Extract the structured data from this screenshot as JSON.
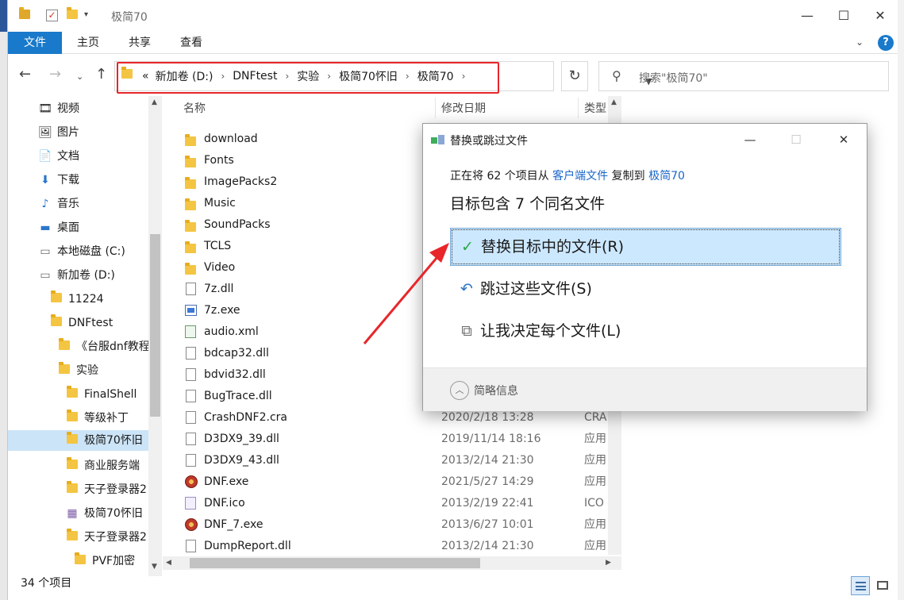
{
  "window": {
    "title": "极简70",
    "minimize_glyph": "—",
    "maximize_glyph": "☐",
    "close_glyph": "✕"
  },
  "ribbon": {
    "file": "文件",
    "home": "主页",
    "share": "共享",
    "view": "查看",
    "help": "?"
  },
  "address": {
    "overflow": "«",
    "crumbs": [
      "新加卷 (D:)",
      "DNFtest",
      "实验",
      "极简70怀旧",
      "极简70"
    ],
    "search_placeholder": "搜索\"极简70\""
  },
  "nav": {
    "items": [
      {
        "label": "视频",
        "icon": "video-icon"
      },
      {
        "label": "图片",
        "icon": "pictures-icon"
      },
      {
        "label": "文档",
        "icon": "documents-icon"
      },
      {
        "label": "下载",
        "icon": "download-icon"
      },
      {
        "label": "音乐",
        "icon": "music-icon"
      },
      {
        "label": "桌面",
        "icon": "desktop-icon"
      },
      {
        "label": "本地磁盘 (C:)",
        "icon": "drive-icon"
      },
      {
        "label": "新加卷 (D:)",
        "icon": "drive-icon"
      },
      {
        "label": "11224",
        "icon": "folder-icon"
      },
      {
        "label": "DNFtest",
        "icon": "folder-icon"
      },
      {
        "label": "《台服dnf教程",
        "icon": "folder-icon"
      },
      {
        "label": "实验",
        "icon": "folder-icon"
      },
      {
        "label": "FinalShell",
        "icon": "folder-icon"
      },
      {
        "label": "等级补丁",
        "icon": "folder-icon"
      },
      {
        "label": "极简70怀旧",
        "icon": "folder-icon"
      },
      {
        "label": "商业服务端",
        "icon": "folder-icon"
      },
      {
        "label": "天子登录器2",
        "icon": "folder-icon"
      },
      {
        "label": "极简70怀旧",
        "icon": "archive-icon"
      },
      {
        "label": "天子登录器2",
        "icon": "folder-icon"
      },
      {
        "label": "PVF加密",
        "icon": "folder-icon"
      }
    ]
  },
  "columns": {
    "name": "名称",
    "date": "修改日期",
    "type": "类型"
  },
  "files": [
    {
      "name": "download",
      "date": "",
      "type": "",
      "icon": "folder-icon"
    },
    {
      "name": "Fonts",
      "date": "",
      "type": "",
      "icon": "folder-icon"
    },
    {
      "name": "ImagePacks2",
      "date": "",
      "type": "",
      "icon": "folder-icon"
    },
    {
      "name": "Music",
      "date": "",
      "type": "",
      "icon": "folder-icon"
    },
    {
      "name": "SoundPacks",
      "date": "",
      "type": "",
      "icon": "folder-icon"
    },
    {
      "name": "TCLS",
      "date": "",
      "type": "",
      "icon": "folder-icon"
    },
    {
      "name": "Video",
      "date": "",
      "type": "",
      "icon": "folder-icon"
    },
    {
      "name": "7z.dll",
      "date": "",
      "type": "",
      "icon": "dll-file-icon"
    },
    {
      "name": "7z.exe",
      "date": "",
      "type": "",
      "icon": "exe-file-icon"
    },
    {
      "name": "audio.xml",
      "date": "",
      "type": "",
      "icon": "xml-file-icon"
    },
    {
      "name": "bdcap32.dll",
      "date": "",
      "type": "",
      "icon": "dll-file-icon"
    },
    {
      "name": "bdvid32.dll",
      "date": "",
      "type": "",
      "icon": "dll-file-icon"
    },
    {
      "name": "BugTrace.dll",
      "date": "",
      "type": "",
      "icon": "dll-file-icon"
    },
    {
      "name": "CrashDNF2.cra",
      "date": "2020/2/18 13:28",
      "type": "CRA",
      "icon": "blank-file-icon"
    },
    {
      "name": "D3DX9_39.dll",
      "date": "2019/11/14 18:16",
      "type": "应用",
      "icon": "dll-file-icon"
    },
    {
      "name": "D3DX9_43.dll",
      "date": "2013/2/14 21:30",
      "type": "应用",
      "icon": "dll-file-icon"
    },
    {
      "name": "DNF.exe",
      "date": "2021/5/27 14:29",
      "type": "应用",
      "icon": "dnf-exe-icon"
    },
    {
      "name": "DNF.ico",
      "date": "2013/2/19 22:41",
      "type": "ICO",
      "icon": "ico-file-icon"
    },
    {
      "name": "DNF_7.exe",
      "date": "2013/6/27 10:01",
      "type": "应用",
      "icon": "dnf-exe-icon"
    },
    {
      "name": "DumpReport.dll",
      "date": "2013/2/14 21:30",
      "type": "应用",
      "icon": "dll-file-icon"
    }
  ],
  "status": {
    "count": "34 个项目"
  },
  "dialog": {
    "title": "替换或跳过文件",
    "copy_prefix": "正在将 62 个项目从",
    "source": "客户端文件",
    "copy_middle": "复制到",
    "destination": "极简70",
    "heading": "目标包含 7 个同名文件",
    "options": {
      "replace": "替换目标中的文件(R)",
      "skip": "跳过这些文件(S)",
      "decide": "让我决定每个文件(L)"
    },
    "details": "简略信息"
  },
  "colors": {
    "accent": "#1979ca",
    "annotation": "#e8262a",
    "selection": "#cce8ff"
  }
}
